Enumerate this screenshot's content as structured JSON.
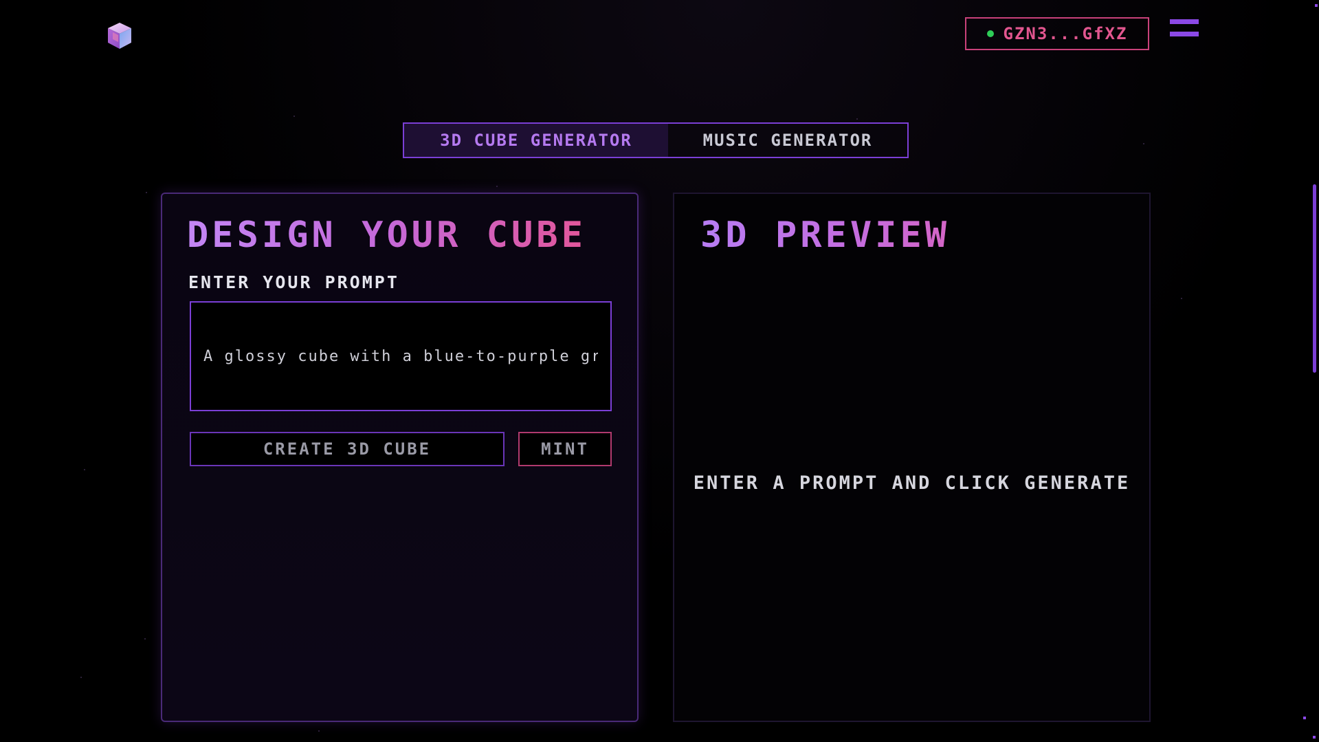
{
  "header": {
    "wallet_address": "GZN3...GfXZ"
  },
  "tabs": [
    {
      "label": "3D CUBE GENERATOR",
      "active": true
    },
    {
      "label": "MUSIC GENERATOR",
      "active": false
    }
  ],
  "design_panel": {
    "title": "DESIGN YOUR CUBE",
    "prompt_label": "ENTER YOUR PROMPT",
    "prompt_value": "A glossy cube with a blue-to-purple gradient",
    "create_button": "CREATE 3D CUBE",
    "mint_button": "MINT"
  },
  "preview_panel": {
    "title": "3D PREVIEW",
    "hint": "ENTER A PROMPT AND CLICK GENERATE"
  },
  "colors": {
    "accent_purple": "#7b3fd6",
    "accent_pink": "#e2568f",
    "status_online": "#2ecc57",
    "background": "#000000"
  },
  "icons": {
    "logo": "cube-logo-icon",
    "menu": "hamburger-menu-icon",
    "status": "online-dot-icon"
  }
}
